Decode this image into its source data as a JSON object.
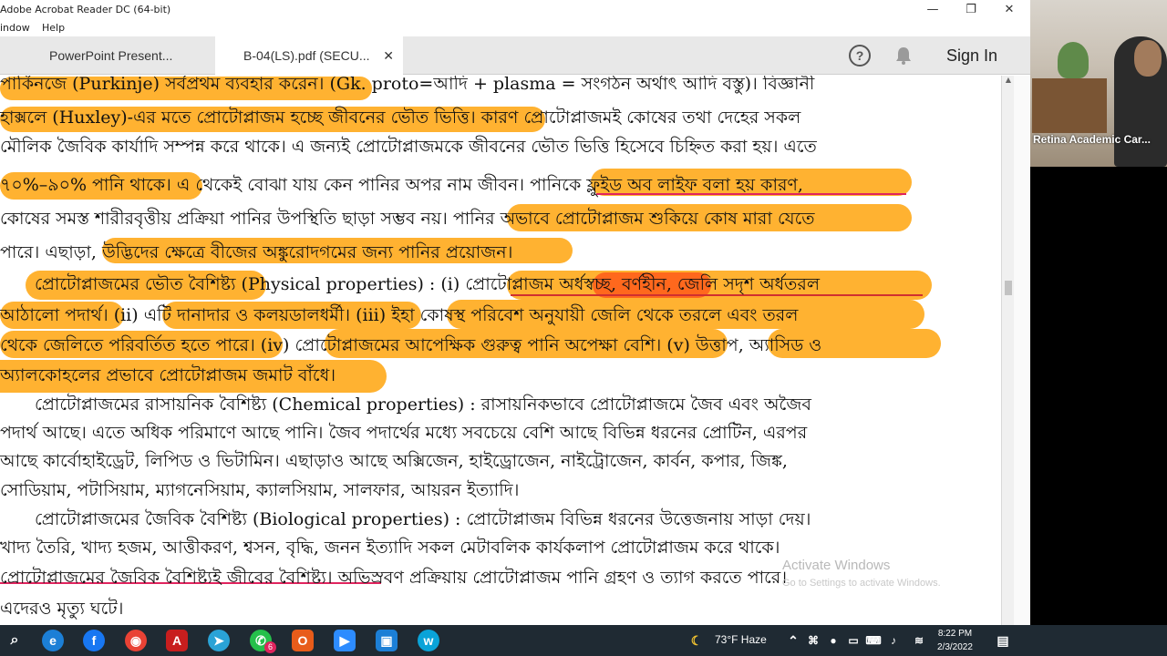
{
  "window": {
    "title": "Adobe Acrobat Reader DC (64-bit)",
    "minimize": "—",
    "maximize": "❐",
    "close": "✕"
  },
  "menu": [
    "indow",
    "Help"
  ],
  "tabs": [
    {
      "label": "PowerPoint Present..."
    },
    {
      "label": "B-04(LS).pdf (SECU...",
      "close": "✕"
    }
  ],
  "toolbar": {
    "help": "?",
    "sign_in": "Sign In"
  },
  "document": {
    "lines": [
      "পার্কিনজে (Purkinje) সর্বপ্রথম ব্যবহার করেন। (Gk. proto=আদি + plasma = সংগঠন অর্থাৎ আদি বস্তু)। বিজ্ঞানী",
      "হাক্সলে (Huxley)-এর মতে প্রোটোপ্লাজম হচ্ছে জীবনের ভৌত ভিত্তি। কারণ প্রোটোপ্লাজমই কোষের তথা দেহের সকল",
      "মৌলিক জৈবিক কার্যাদি সম্পন্ন করে থাকে। এ জন্যই প্রোটোপ্লাজমকে জীবনের ভৌত ভিত্তি হিসেবে চিহ্নিত করা হয়। এতে",
      "৭০%–৯০% পানি থাকে। এ থেকেই বোঝা যায় কেন পানির অপর নাম জীবন। পানিকে ফ্লুইড অব লাইফ বলা হয় কারণ,",
      "কোষের সমস্ত শারীরবৃত্তীয় প্রক্রিয়া পানির উপস্থিতি ছাড়া সম্ভব নয়। পানির অভাবে প্রোটোপ্লাজম শুকিয়ে কোষ মারা যেতে",
      "পারে। এছাড়া, উদ্ভিদের ক্ষেত্রে বীজের অঙ্কুরোদগমের জন্য পানির প্রয়োজন।",
      "প্রোটোপ্লাজমের ভৌত বৈশিষ্ট্য (Physical properties) : (i) প্রোটোপ্লাজম অর্ধস্বচ্ছ, বর্ণহীন, জেলি সদৃশ অর্ধতরল",
      "আঠালো পদার্থ। (ii) এটি দানাদার ও কলয়ডালধর্মী। (iii) ইহা কোষস্থ পরিবেশ অনুযায়ী জেলি থেকে তরলে এবং তরল",
      "থেকে জেলিতে পরিবর্তিত হতে পারে। (iv) প্রোটোপ্লাজমের আপেক্ষিক গুরুত্ব পানি অপেক্ষা বেশি। (v) উত্তাপ, অ্যাসিড ও",
      "অ্যালকোহলের প্রভাবে প্রোটোপ্লাজম জমাট বাঁধে।",
      "প্রোটোপ্লাজমের রাসায়নিক বৈশিষ্ট্য (Chemical properties) : রাসায়নিকভাবে প্রোটোপ্লাজমে জৈব এবং অজৈব",
      "পদার্থ আছে। এতে অধিক পরিমাণে আছে পানি। জৈব পদার্থের মধ্যে সবচেয়ে বেশি আছে বিভিন্ন ধরনের প্রোটিন, এরপর",
      "আছে কার্বোহাইড্রেট, লিপিড ও ভিটামিন। এছাড়াও আছে অক্সিজেন, হাইড্রোজেন, নাইট্রোজেন, কার্বন, কপার, জিঙ্ক,",
      "সোডিয়াম, পটাসিয়াম, ম্যাগনেসিয়াম, ক্যালসিয়াম, সালফার, আয়রন ইত্যাদি।",
      "প্রোটোপ্লাজমের জৈবিক বৈশিষ্ট্য (Biological properties) : প্রোটোপ্লাজম বিভিন্ন ধরনের উত্তেজনায় সাড়া দেয়।",
      "খাদ্য তৈরি, খাদ্য হজম, আত্তীকরণ, শ্বসন, বৃদ্ধি, জনন ইত্যাদি সকল মেটাবলিক কার্যকলাপ প্রোটোপ্লাজম করে থাকে।",
      "প্রোটোপ্লাজমের জৈবিক বৈশিষ্ট্যই জীবের বৈশিষ্ট্য। অভিস্রবণ প্রক্রিয়ায় প্রোটোপ্লাজম পানি গ্রহণ ও ত্যাগ করতে পারে।",
      "এদেরও মৃত্যু ঘটে।"
    ]
  },
  "watermark": {
    "title": "Activate Windows",
    "subtitle": "Go to Settings to activate Windows."
  },
  "webcam": {
    "label": "Retina Academic Car..."
  },
  "taskbar": {
    "weather": "73°F  Haze",
    "time": "8:22 PM",
    "date": "2/3/2022",
    "notification_badge": "6"
  },
  "colors": {
    "highlight": "#ffab1f",
    "highlight_red": "#ff5a1a",
    "underline": "#e0245e",
    "taskbar": "#1f2a33"
  }
}
